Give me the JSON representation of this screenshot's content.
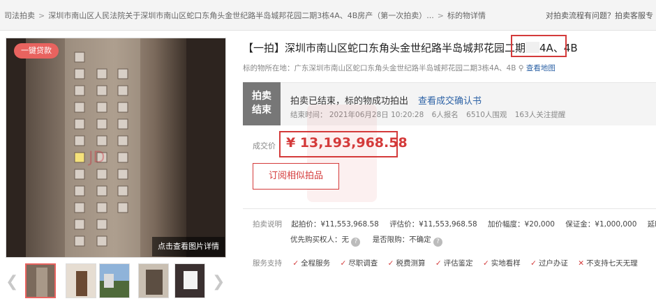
{
  "breadcrumb": {
    "root": "司法拍卖",
    "court": "深圳市南山区人民法院关于深圳市南山区蛇口东角头金世纪路半岛城邦花园二期3栋4A、4B房产（第一次拍卖）...",
    "current": "标的物详情"
  },
  "header_right": {
    "help": "对拍卖流程有问题？拍卖客服专"
  },
  "gallery": {
    "badge": "一键贷款",
    "caption": "点击查看图片详情",
    "prev_icon": "chevron-left-icon",
    "next_icon": "chevron-right-icon"
  },
  "title": {
    "text": "【一拍】深圳市南山区蛇口东角头金世纪路半岛城邦花园二期",
    "units": "4A、4B"
  },
  "location": {
    "text": "标的物所在地：广东深圳市南山区蛇口东角头金世纪路半岛城邦花园二期3栋4A、4B",
    "map_link": "查看地图"
  },
  "status": {
    "tag_line1": "拍卖",
    "tag_line2": "结束",
    "message": "拍卖已结束，标的物成功拍出",
    "confirm_link": "查看成交确认书",
    "end_time": "结束时间： 2021年06月28日 10:20:28",
    "signups": "6人报名",
    "views": "6510人围观",
    "followers": "163人关注提醒"
  },
  "price": {
    "label": "成交价",
    "value": "¥ 13,193,968.58"
  },
  "subscribe_label": "订阅相似拍品",
  "description": {
    "label": "拍卖说明",
    "start_price": "起拍价：¥11,553,968.58",
    "appraisal": "评估价：¥11,553,968.58",
    "increment": "加价幅度：¥20,000",
    "deposit": "保证金：¥1,000,000",
    "delay": "延时周",
    "priority": "优先购买权人：无",
    "restriction": "是否限购：不确定"
  },
  "services": {
    "label": "服务支持",
    "items": [
      "全程服务",
      "尽职调查",
      "税费测算",
      "评估鉴定",
      "实地看样",
      "过户办证"
    ],
    "no_return": "不支持七天无理"
  },
  "colors": {
    "accent": "#d43a3a",
    "link": "#2e63a6",
    "badge": "#e8635f"
  }
}
